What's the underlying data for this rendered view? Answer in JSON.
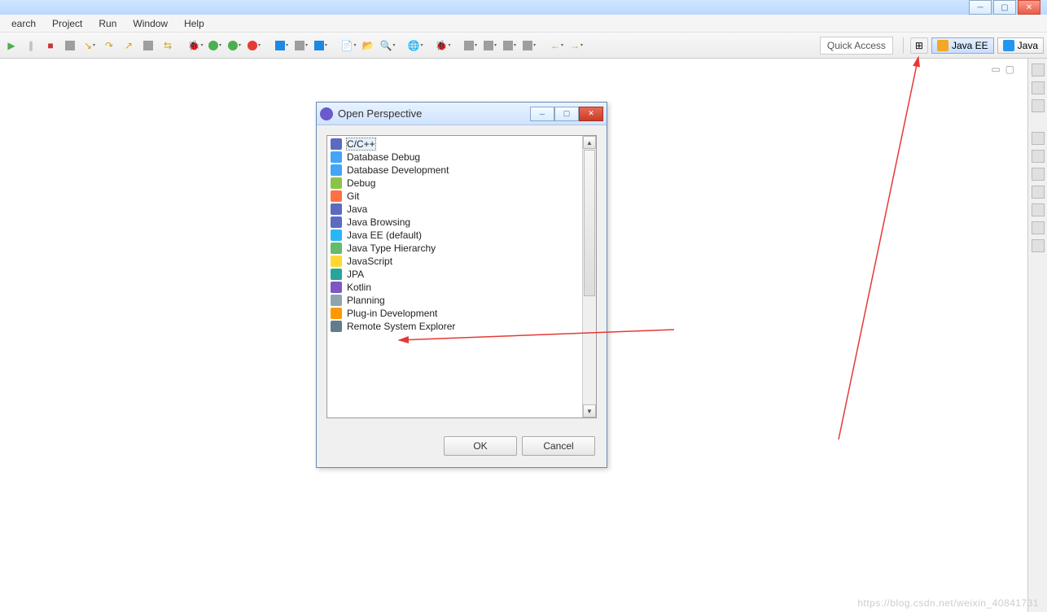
{
  "menu": {
    "items": [
      "earch",
      "Project",
      "Run",
      "Window",
      "Help"
    ]
  },
  "quick_access": "Quick Access",
  "perspectives": {
    "open_icon": "open-perspective-icon",
    "items": [
      {
        "label": "Java EE",
        "active": true
      },
      {
        "label": "Java",
        "active": false
      }
    ]
  },
  "dialog": {
    "title": "Open Perspective",
    "buttons": {
      "ok": "OK",
      "cancel": "Cancel"
    },
    "items": [
      {
        "label": "C/C++",
        "icon": "c-icon",
        "selected": true
      },
      {
        "label": "Database Debug",
        "icon": "db-debug-icon"
      },
      {
        "label": "Database Development",
        "icon": "db-dev-icon"
      },
      {
        "label": "Debug",
        "icon": "bug-icon"
      },
      {
        "label": "Git",
        "icon": "git-icon"
      },
      {
        "label": "Java",
        "icon": "java-icon"
      },
      {
        "label": "Java Browsing",
        "icon": "java-browsing-icon"
      },
      {
        "label": "Java EE (default)",
        "icon": "javaee-icon"
      },
      {
        "label": "Java Type Hierarchy",
        "icon": "hierarchy-icon"
      },
      {
        "label": "JavaScript",
        "icon": "js-icon"
      },
      {
        "label": "JPA",
        "icon": "jpa-icon"
      },
      {
        "label": "Kotlin",
        "icon": "kotlin-icon"
      },
      {
        "label": "Planning",
        "icon": "planning-icon"
      },
      {
        "label": "Plug-in Development",
        "icon": "plugin-icon"
      },
      {
        "label": "Remote System Explorer",
        "icon": "remote-icon"
      }
    ]
  },
  "watermark": "https://blog.csdn.net/weixin_40841731"
}
